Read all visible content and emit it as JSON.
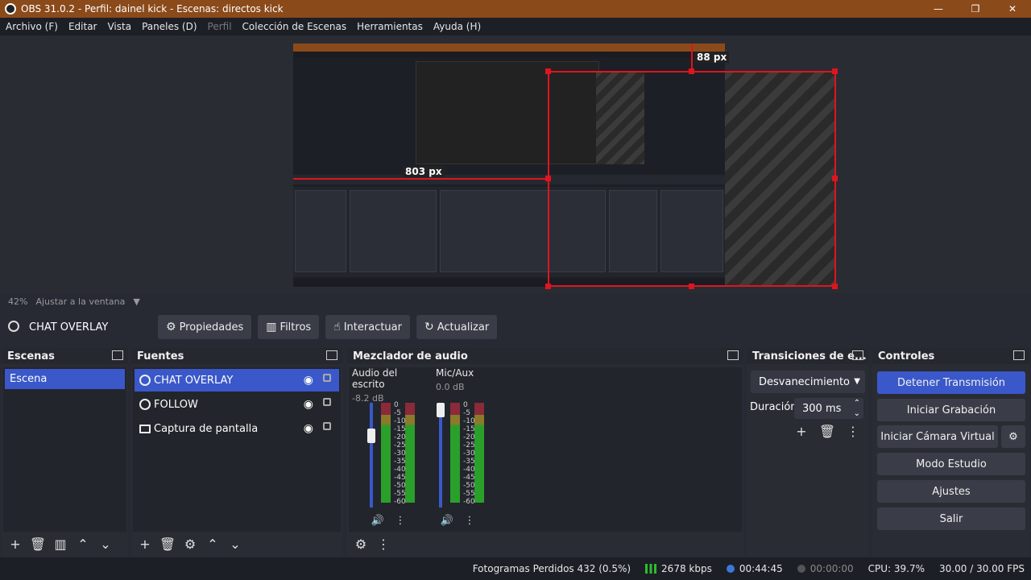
{
  "window": {
    "title": "OBS 31.0.2 - Perfil: dainel kick - Escenas: directos kick",
    "minimize": "—",
    "maximize": "❐",
    "close": "✕"
  },
  "menu": {
    "items": [
      "Archivo (F)",
      "Editar",
      "Vista",
      "Paneles (D)",
      "Perfil",
      "Colección de Escenas",
      "Herramientas",
      "Ayuda (H)"
    ]
  },
  "preview": {
    "label_top": "88 px",
    "label_left": "803 px"
  },
  "zoom": {
    "percent": "42%",
    "mode": "Ajustar a la ventana"
  },
  "source_toolbar": {
    "current_source": "CHAT OVERLAY",
    "properties": "Propiedades",
    "filters": "Filtros",
    "interact": "Interactuar",
    "refresh": "Actualizar"
  },
  "docks": {
    "scenes": {
      "title": "Escenas",
      "items": [
        "Escena"
      ]
    },
    "sources": {
      "title": "Fuentes",
      "items": [
        "CHAT OVERLAY",
        "FOLLOW",
        "Captura de pantalla"
      ]
    },
    "mixer": {
      "title": "Mezclador de audio",
      "channels": [
        {
          "name": "Audio del escrito",
          "db": "-8.2 dB"
        },
        {
          "name": "Mic/Aux",
          "db": "0.0 dB"
        }
      ],
      "ticks": [
        "0",
        "-5",
        "-10",
        "-15",
        "-20",
        "-25",
        "-30",
        "-35",
        "-40",
        "-45",
        "-50",
        "-55",
        "-60"
      ]
    },
    "transitions": {
      "title": "Transiciones de e...",
      "type": "Desvanecimiento",
      "duration_label": "Duración",
      "duration": "300 ms"
    },
    "controls": {
      "title": "Controles",
      "buttons": [
        "Detener Transmisión",
        "Iniciar Grabación",
        "Iniciar Cámara Virtual",
        "Modo Estudio",
        "Ajustes",
        "Salir"
      ]
    }
  },
  "status": {
    "dropped": "Fotogramas Perdidos 432 (0.5%)",
    "bitrate": "2678 kbps",
    "stream_time": "00:44:45",
    "rec_time": "00:00:00",
    "cpu": "CPU: 39.7%",
    "fps": "30.00 / 30.00 FPS"
  },
  "colors": {
    "accent": "#3a58c9",
    "selection": "#e0141e",
    "titlebar": "#8b4a1a"
  }
}
